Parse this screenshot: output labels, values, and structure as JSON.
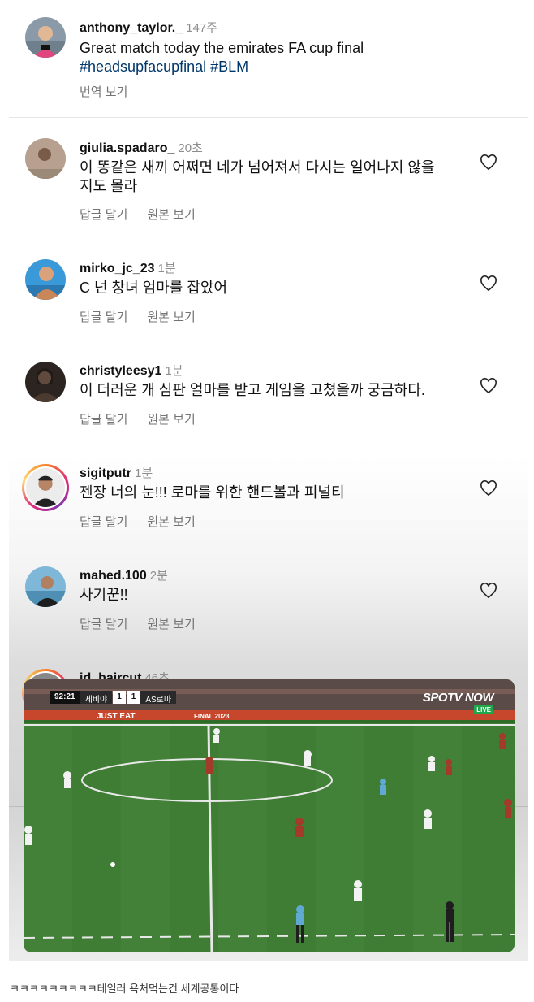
{
  "post": {
    "username": "anthony_taylor._",
    "time": "147주",
    "text": "Great match today the emirates FA cup final",
    "hashtags": "#headsupfacupfinal #BLM",
    "translate": "번역 보기"
  },
  "comments": [
    {
      "username": "giulia.spadaro_",
      "time": "20초",
      "text_line1": "이 똥같은 새끼 어쩌면 네가 넘어져서 다시는 일어나지 않을",
      "text_line2": "지도 몰라",
      "reply": "답글 달기",
      "original": "원본 보기"
    },
    {
      "username": "mirko_jc_23",
      "time": "1분",
      "text": "C 넌 창녀 엄마를 잡았어",
      "reply": "답글 달기",
      "original": "원본 보기"
    },
    {
      "username": "christyleesy1",
      "time": "1분",
      "text": "이 더러운 개 심판 얼마를 받고 게임을 고쳤을까 궁금하다.",
      "reply": "답글 달기",
      "original": "원본 보기"
    },
    {
      "username": "sigitputr",
      "time": "1분",
      "text": "젠장 너의 눈!!! 로마를 위한 핸드볼과 피널티",
      "reply": "답글 달기",
      "original": "원본 보기"
    },
    {
      "username": "mahed.100",
      "time": "2분",
      "text": "사기꾼!!",
      "reply": "답글 달기",
      "original": "원본 보기"
    },
    {
      "username": "id_haircut",
      "time": "46초"
    }
  ],
  "video": {
    "clock": "92:21",
    "home_team": "세비야",
    "home_score": "1",
    "away_score": "1",
    "away_team": "AS로마",
    "broadcaster": "SPOTV NOW",
    "live": "LIVE",
    "board_text": "JUST EAT",
    "board_center": "FINAL 2023"
  },
  "caption": "ㅋㅋㅋㅋㅋㅋㅋㅋㅋ테일러 욕처먹는건 세계공통이다",
  "colors": {
    "hashtag": "#00376b",
    "meta": "#737373",
    "time": "#8e8e8e",
    "pitch": "#3f7d35"
  },
  "icons": [
    "heart-icon"
  ]
}
